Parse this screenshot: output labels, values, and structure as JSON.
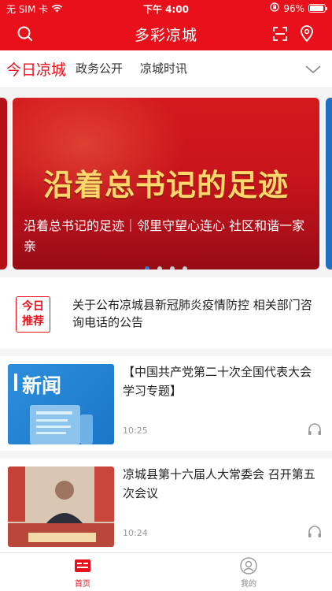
{
  "status_bar": {
    "carrier": "无 SIM 卡",
    "time": "下午 4:00",
    "battery_text": "96%",
    "battery_level": 0.96
  },
  "header": {
    "title": "多彩凉城"
  },
  "categories": [
    {
      "label": "今日凉城",
      "active": true
    },
    {
      "label": "政务公开",
      "active": false
    },
    {
      "label": "凉城时讯",
      "active": false
    }
  ],
  "banner": {
    "headline": "沿着总书记的足迹",
    "caption": "沿着总书记的足迹｜邻里守望心连心 社区和谐一家亲",
    "slide_count": 4,
    "active_slide": 1
  },
  "recommend": {
    "badge_line1": "今日",
    "badge_line2": "推荐",
    "text": "关于公布凉城县新冠肺炎疫情防控 相关部门咨询电话的公告"
  },
  "news": [
    {
      "title": "【中国共产党第二十次全国代表大会学习专题】",
      "time": "10:25",
      "thumb_label": "新闻"
    },
    {
      "title": "凉城县第十六届人大常委会 召开第五次会议",
      "time": "10:24",
      "thumb_label": ""
    }
  ],
  "tabs": [
    {
      "label": "首页",
      "active": true
    },
    {
      "label": "我的",
      "active": false
    }
  ],
  "colors": {
    "brand_red": "#e8101b",
    "dot_active": "#3a7bd5",
    "dot_inactive": "#c9c9c9"
  }
}
